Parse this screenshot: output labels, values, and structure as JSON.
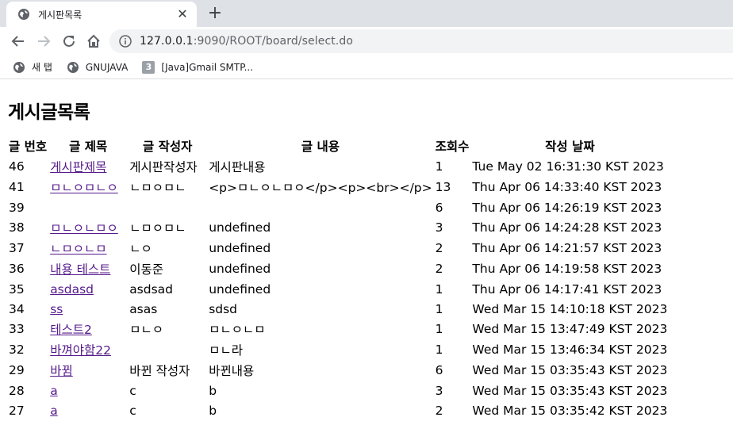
{
  "browser": {
    "tab_title": "게시판목록",
    "new_tab_symbol": "+",
    "close_symbol": "✕",
    "url_host": "127.0.0.1",
    "url_rest": ":9090/ROOT/board/select.do",
    "bookmarks": [
      {
        "label": "새 탭",
        "icon": "globe-icon"
      },
      {
        "label": "GNUJAVA",
        "icon": "globe-icon"
      },
      {
        "label": "[Java]Gmail SMTP...",
        "icon": "number-3-icon",
        "icon_text": "3"
      }
    ]
  },
  "page": {
    "title": "게시글목록",
    "columns": [
      "글 번호",
      "글 제목",
      "글 작성자",
      "글 내용",
      "조회수",
      "작성 날짜"
    ],
    "rows": [
      {
        "no": "46",
        "title": "게시판제목",
        "writer": "게시판작성자",
        "content": "게시판내용",
        "views": "1",
        "date": "Tue May 02 16:31:30 KST 2023"
      },
      {
        "no": "41",
        "title": "ㅁㄴㅇㅁㄴㅇ",
        "writer": "ㄴㅁㅇㅁㄴ",
        "content": "<p>ㅁㄴㅇㄴㅁㅇ</p><p><br></p>",
        "views": "13",
        "date": "Thu Apr 06 14:33:40 KST 2023"
      },
      {
        "no": "39",
        "title": "",
        "writer": "",
        "content": "",
        "views": "6",
        "date": "Thu Apr 06 14:26:19 KST 2023"
      },
      {
        "no": "38",
        "title": "ㅁㄴㅇㄴㅁㅇ",
        "writer": "ㄴㅁㅇㅁㄴ",
        "content": "undefined",
        "views": "3",
        "date": "Thu Apr 06 14:24:28 KST 2023"
      },
      {
        "no": "37",
        "title": "ㄴㅁㅇㄴㅁ",
        "writer": "ㄴㅇ",
        "content": "undefined",
        "views": "2",
        "date": "Thu Apr 06 14:21:57 KST 2023"
      },
      {
        "no": "36",
        "title": "내용 테스트",
        "writer": "이동준",
        "content": "undefined",
        "views": "2",
        "date": "Thu Apr 06 14:19:58 KST 2023"
      },
      {
        "no": "35",
        "title": "asdasd",
        "writer": "asdsad",
        "content": "undefined",
        "views": "1",
        "date": "Thu Apr 06 14:17:41 KST 2023"
      },
      {
        "no": "34",
        "title": "ss",
        "writer": "asas",
        "content": "sdsd",
        "views": "1",
        "date": "Wed Mar 15 14:10:18 KST 2023"
      },
      {
        "no": "33",
        "title": "테스트2",
        "writer": "ㅁㄴㅇ",
        "content": "ㅁㄴㅇㄴㅁ",
        "views": "1",
        "date": "Wed Mar 15 13:47:49 KST 2023"
      },
      {
        "no": "32",
        "title": "바껴야함22",
        "writer": "",
        "content": "ㅁㄴ라",
        "views": "1",
        "date": "Wed Mar 15 13:46:34 KST 2023"
      },
      {
        "no": "29",
        "title": "바뀜",
        "writer": "바뀐 작성자",
        "content": "바뀐내용",
        "views": "6",
        "date": "Wed Mar 15 03:35:43 KST 2023"
      },
      {
        "no": "28",
        "title": "a",
        "writer": "c",
        "content": "b",
        "views": "3",
        "date": "Wed Mar 15 03:35:43 KST 2023"
      },
      {
        "no": "27",
        "title": "a",
        "writer": "c",
        "content": "b",
        "views": "2",
        "date": "Wed Mar 15 03:35:42 KST 2023"
      }
    ]
  }
}
